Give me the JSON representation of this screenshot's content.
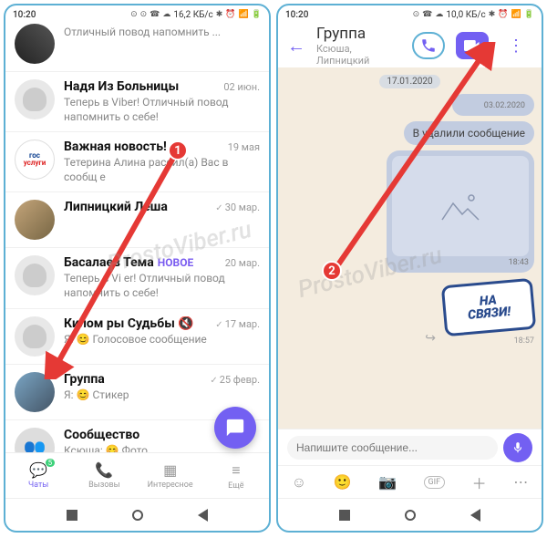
{
  "status": {
    "time": "10:20",
    "left_net": "16,2 КБ/с",
    "right_net": "10,0 КБ/с"
  },
  "left": {
    "chats": [
      {
        "name": "",
        "preview": "Отличный повод напомнить ...",
        "time": ""
      },
      {
        "name": "Надя Из Больницы",
        "preview": "Теперь в Viber! Отличный повод напомнить о себе!",
        "time": "02 июн."
      },
      {
        "name": "Важная новость!",
        "preview": "Тетерина Алина рассил(а) Вас в сообщ   е",
        "time": "19 мая"
      },
      {
        "name": "Липницкий Леша",
        "preview": "",
        "time": "30 мар.",
        "checked": true
      },
      {
        "name": "Басалаев Тема",
        "preview": "Теперь в Vi er! Отличный повод напомнить о себе!",
        "time": "20 мар.",
        "badge": "НОВОЕ"
      },
      {
        "name": "Килом  ры Судьбы",
        "preview": "Я: 😊 Голосовое сообщение",
        "time": "17 мар.",
        "checked": true
      },
      {
        "name": "Группа",
        "preview": "Я: 😊 Стикер",
        "time": "25 февр.",
        "checked": true
      },
      {
        "name": "Сообщество",
        "preview": "Ксюша: 😊 Фото",
        "time": ""
      }
    ],
    "tabs": {
      "chats": "Чаты",
      "calls": "Вызовы",
      "explore": "Интересное",
      "more": "Ещё",
      "badge": "5"
    }
  },
  "right": {
    "header": {
      "title": "Группа",
      "subtitle": "Ксюша, Липницкий"
    },
    "date1": "17.01.2020",
    "msg1_time": "03.02.2020",
    "msg2_text": "В   удалили сообщение",
    "img_time": "18:43",
    "sticker_text1": "НА",
    "sticker_text2": "СВЯЗИ!",
    "sticker_time": "18:57",
    "composer_placeholder": "Напишите сообщение..."
  },
  "watermark": "ProstoViber.ru",
  "anno": {
    "n1": "1",
    "n2": "2"
  }
}
